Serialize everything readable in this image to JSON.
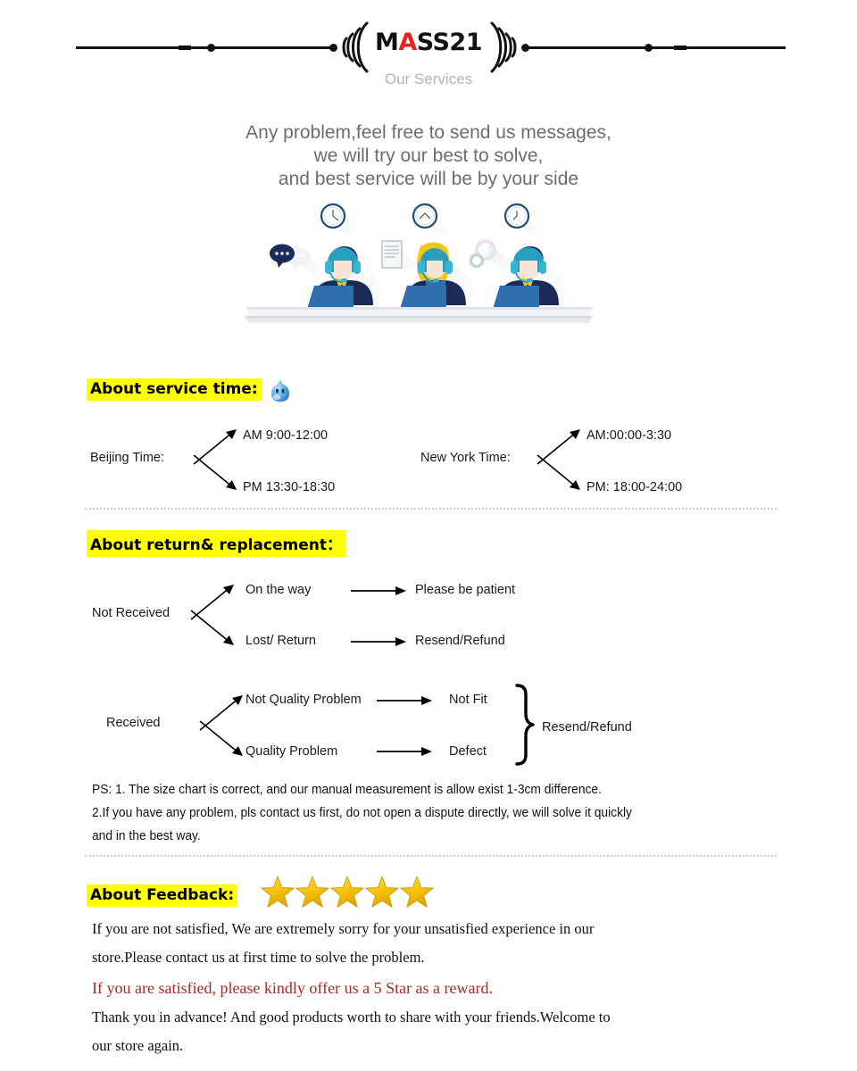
{
  "header": {
    "brand_main": "M",
    "brand_red": "A",
    "brand_rest": "SS21",
    "brand_full": "MASS21",
    "subtitle": "Our Services"
  },
  "intro": {
    "line1": "Any problem,feel free to send us messages,",
    "line2": "we will try our best to solve,",
    "line3": "and best service will be by your side"
  },
  "illustration": {
    "alt": "three customer service agents with headsets at desks with laptops, wall clocks above"
  },
  "service_time": {
    "heading": "About service time:",
    "emoji": "blue-blob-face-emoji",
    "beijing": {
      "label": "Beijing Time:",
      "am": "AM 9:00-12:00",
      "pm": "PM 13:30-18:30"
    },
    "newyork": {
      "label": "New York Time:",
      "am": "AM:00:00-3:30",
      "pm": "PM: 18:00-24:00"
    }
  },
  "return_replacement": {
    "heading": "About return& replacement：",
    "not_received": {
      "root": "Not Received",
      "branch1": "On the way",
      "result1": "Please be patient",
      "branch2": "Lost/ Return",
      "result2": "Resend/Refund"
    },
    "received": {
      "root": "Received",
      "branch1": "Not Quality Problem",
      "result1": "Not Fit",
      "branch2": "Quality Problem",
      "result2": "Defect",
      "brace_result": "Resend/Refund"
    },
    "ps": {
      "line1": "PS: 1. The size chart is correct, and  our manual measurement  is allow  exist 1-3cm difference.",
      "line2": "2.If you have any problem, pls contact us first, do not open a dispute directly, we will solve it quickly",
      "line3": "and in the best way."
    }
  },
  "feedback": {
    "heading": "About Feedback:",
    "star_count": 5,
    "star_color": "#f5c518",
    "line1": "If you are not satisfied, We are extremely sorry for your unsatisfied experience in our",
    "line2": "store.Please contact us at first time to solve the problem.",
    "line3_red": "If you are satisfied, please kindly offer us a 5 Star as a reward.",
    "line4": "Thank you in advance! And good products worth to share with your friends.Welcome to",
    "line5": "our store again."
  },
  "colors": {
    "highlight": "#ffff00",
    "brand_red": "#e8201e",
    "red_text": "#a52a2a",
    "gray_text": "#6d6d6d",
    "divider": "#c9c9c9"
  }
}
